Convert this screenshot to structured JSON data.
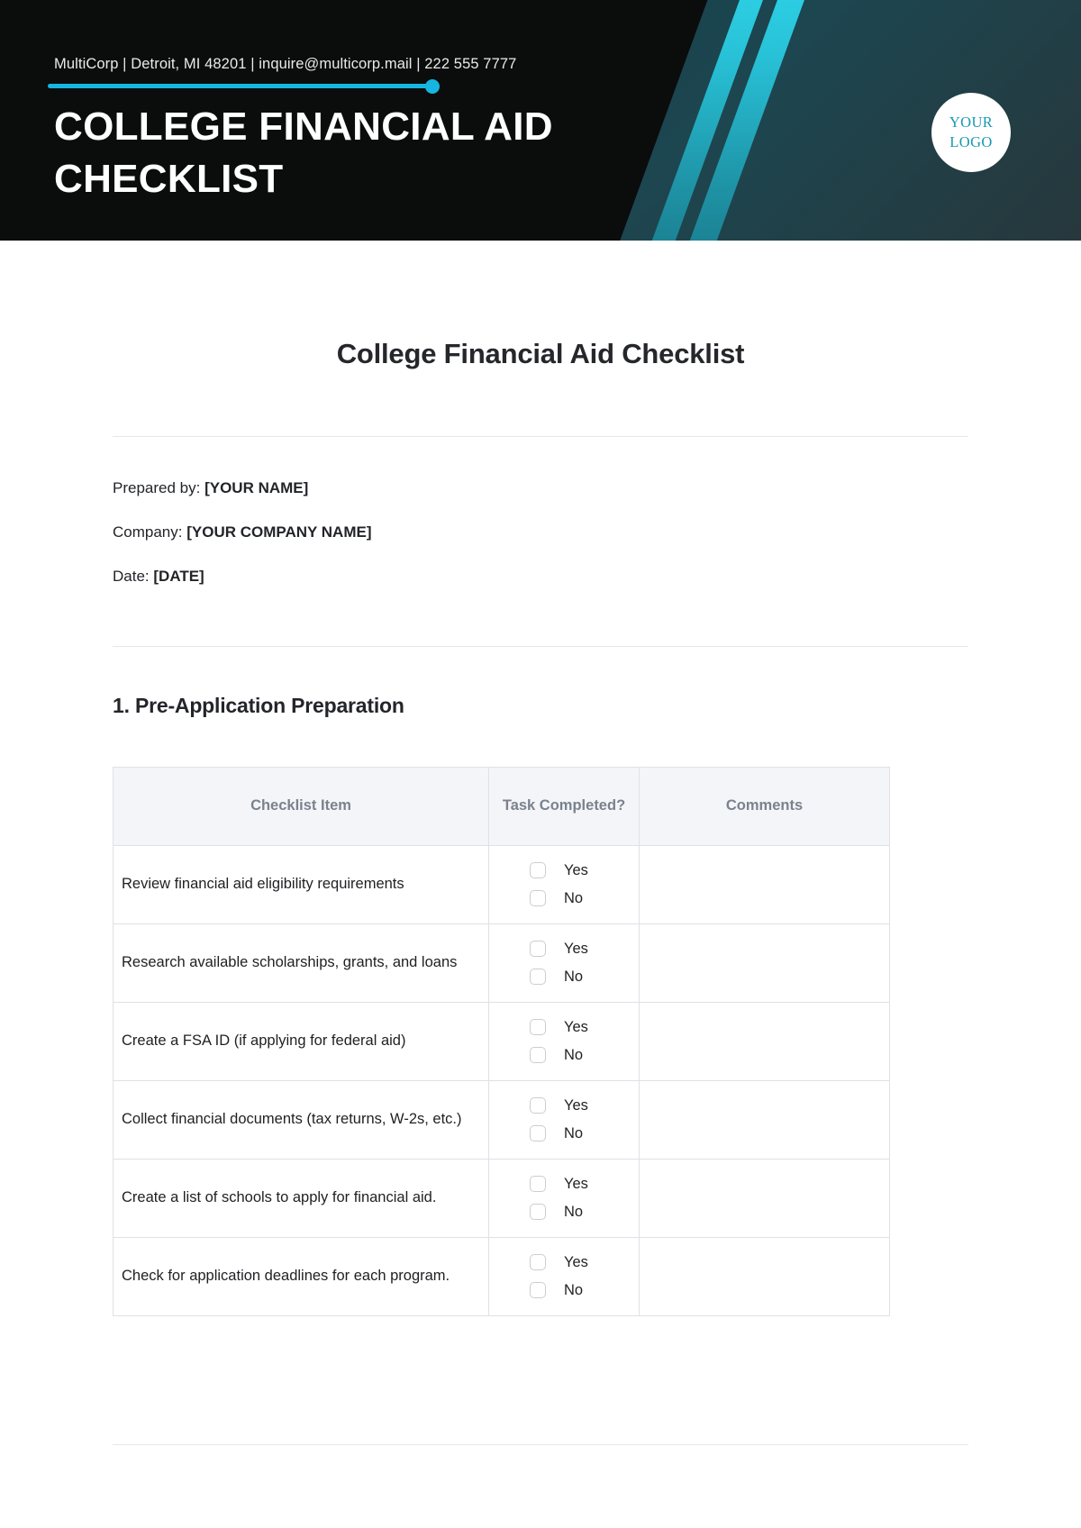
{
  "banner": {
    "contact": "MultiCorp | Detroit, MI 48201 | inquire@multicorp.mail | 222 555 7777",
    "title": "COLLEGE FINANCIAL AID CHECKLIST",
    "logo_line_1": "YOUR",
    "logo_line_2": "LOGO",
    "accent_color": "#16b6e0",
    "stripe_color": "#2fd8ec",
    "background_color": "#0b0c0c",
    "gradient_color": "#1d4650",
    "logo_text_color": "#1899b0"
  },
  "document": {
    "title": "College Financial Aid Checklist",
    "meta": [
      {
        "label": "Prepared by:",
        "value": "[YOUR NAME]"
      },
      {
        "label": "Company:",
        "value": "[YOUR COMPANY NAME]"
      },
      {
        "label": "Date:",
        "value": "[DATE]"
      }
    ],
    "section": {
      "heading": "1. Pre-Application Preparation",
      "table": {
        "headers": [
          "Checklist Item",
          "Task Completed?",
          "Comments"
        ],
        "options": [
          "Yes",
          "No"
        ],
        "rows": [
          {
            "item": "Review financial aid eligibility requirements",
            "comment": ""
          },
          {
            "item": "Research available scholarships, grants, and loans",
            "comment": ""
          },
          {
            "item": "Create a FSA ID (if applying for federal aid)",
            "comment": ""
          },
          {
            "item": "Collect financial documents (tax returns, W-2s, etc.)",
            "comment": ""
          },
          {
            "item": "Create a list of schools to apply for financial aid.",
            "comment": ""
          },
          {
            "item": "Check for application deadlines for each program.",
            "comment": ""
          }
        ]
      }
    }
  }
}
